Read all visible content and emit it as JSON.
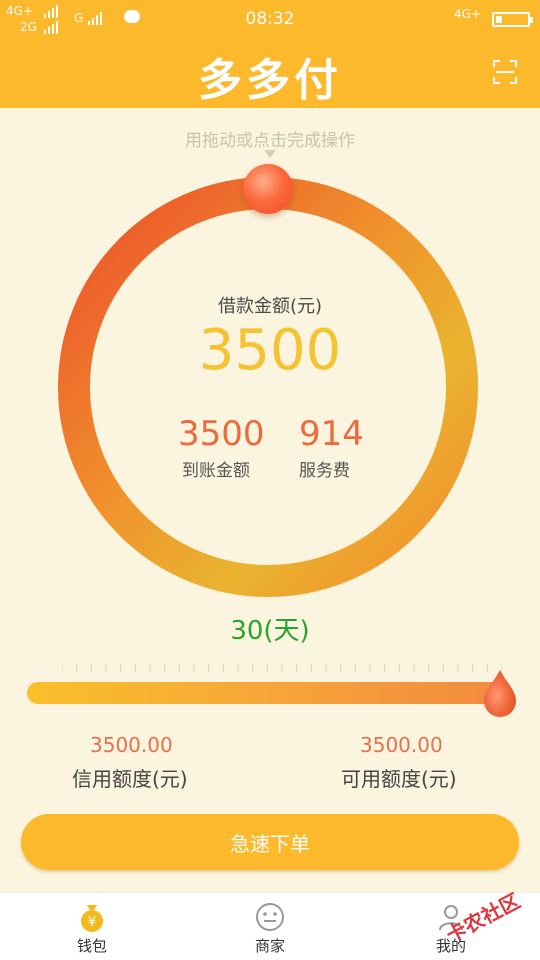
{
  "status_bar": {
    "network1": "4G+",
    "network2": "2G",
    "network3": "G",
    "time": "08:32",
    "network_right": "4G+"
  },
  "header": {
    "logo_text": "多多付",
    "scan_icon": "scan-icon"
  },
  "hint": "用拖动或点击完成操作",
  "loan": {
    "label": "借款金额(元)",
    "amount": "3500",
    "received_value": "3500",
    "received_label": "到账金额",
    "fee_value": "914",
    "fee_label": "服务费"
  },
  "term": {
    "days": "30(天)",
    "slider_fraction": 1.0
  },
  "credit": {
    "limit_value": "3500.00",
    "limit_label": "信用额度(元)",
    "available_value": "3500.00",
    "available_label": "可用额度(元)"
  },
  "order_button": "急速下单",
  "tabs": [
    {
      "label": "钱包",
      "icon": "wallet-icon",
      "active": true
    },
    {
      "label": "商家",
      "icon": "merchant-icon",
      "active": false
    },
    {
      "label": "我的",
      "icon": "profile-icon",
      "active": false
    }
  ],
  "watermark": "卡农社区",
  "colors": {
    "brand": "#fbb92b",
    "background": "#fbf4de",
    "amount": "#f6c330",
    "stat": "#ec6b3c",
    "days": "#2aa52c"
  }
}
